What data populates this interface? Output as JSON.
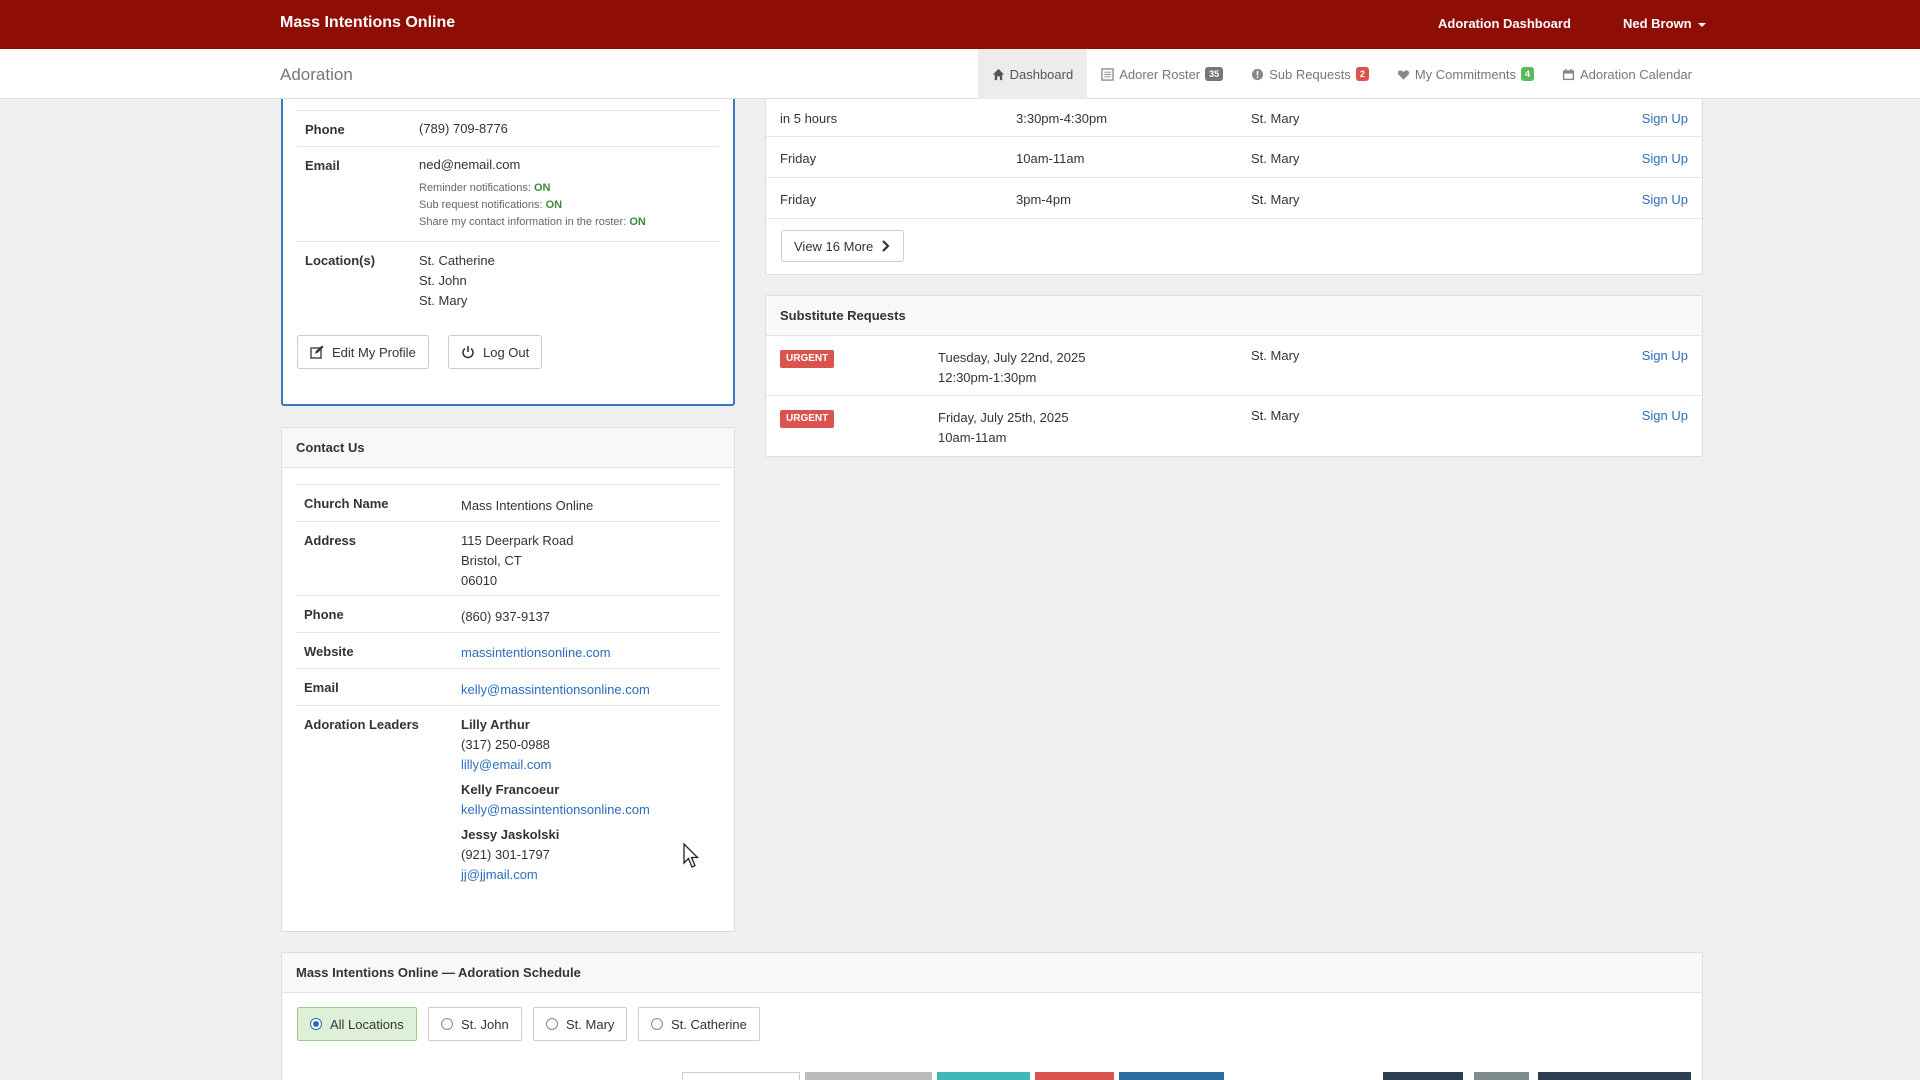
{
  "topbar": {
    "brand": "Mass Intentions Online",
    "dashboard_link": "Adoration Dashboard",
    "user_menu": "Ned Brown"
  },
  "subnav": {
    "title": "Adoration",
    "tabs": [
      {
        "label": "Dashboard",
        "icon": "home-icon",
        "badge": ""
      },
      {
        "label": "Adorer Roster",
        "icon": "list-icon",
        "badge": "35"
      },
      {
        "label": "Sub Requests",
        "icon": "info-icon",
        "badge": "2"
      },
      {
        "label": "My Commitments",
        "icon": "heart-icon",
        "badge": "4"
      },
      {
        "label": "Adoration Calendar",
        "icon": "calendar-icon",
        "badge": ""
      }
    ]
  },
  "profile": {
    "phone_label": "Phone",
    "phone": "(789) 709-8776",
    "email_label": "Email",
    "email": "ned@nemail.com",
    "reminder_label": "Reminder notifications:",
    "reminder_value": "ON",
    "subreq_label": "Sub request notifications:",
    "subreq_value": "ON",
    "share_label": "Share my contact information in the roster:",
    "share_value": "ON",
    "locations_label": "Location(s)",
    "locations": [
      "St. Catherine",
      "St. John",
      "St. Mary"
    ],
    "edit_button": "Edit My Profile",
    "logout_button": "Log Out"
  },
  "contact": {
    "heading": "Contact Us",
    "church_label": "Church Name",
    "church": "Mass Intentions Online",
    "address_label": "Address",
    "address": [
      "115 Deerpark Road",
      "Bristol, CT",
      "06010"
    ],
    "phone_label": "Phone",
    "phone": "(860) 937-9137",
    "website_label": "Website",
    "website": "massintentionsonline.com",
    "email_label": "Email",
    "email": "kelly@massintentionsonline.com",
    "leaders_label": "Adoration Leaders",
    "leaders": [
      {
        "name": "Lilly Arthur",
        "phone": "(317) 250-0988",
        "email": "lilly@email.com"
      },
      {
        "name": "Kelly Francoeur",
        "phone": "",
        "email": "kelly@massintentionsonline.com"
      },
      {
        "name": "Jessy Jaskolski",
        "phone": "(921) 301-1797",
        "email": "jj@jjmail.com"
      }
    ]
  },
  "open_hours": {
    "rows": [
      {
        "when": "in 5 hours",
        "time": "3:30pm-4:30pm",
        "location": "St. Mary",
        "action": "Sign Up"
      },
      {
        "when": "Friday",
        "time": "10am-11am",
        "location": "St. Mary",
        "action": "Sign Up"
      },
      {
        "when": "Friday",
        "time": "3pm-4pm",
        "location": "St. Mary",
        "action": "Sign Up"
      }
    ],
    "view_more": "View 16 More"
  },
  "sub_requests": {
    "heading": "Substitute Requests",
    "rows": [
      {
        "badge": "URGENT",
        "date": "Tuesday, July 22nd, 2025",
        "time": "12:30pm-1:30pm",
        "location": "St. Mary",
        "action": "Sign Up"
      },
      {
        "badge": "URGENT",
        "date": "Friday, July 25th, 2025",
        "time": "10am-11am",
        "location": "St. Mary",
        "action": "Sign Up"
      }
    ]
  },
  "schedule": {
    "heading": "Mass Intentions Online — Adoration Schedule",
    "filters": [
      "All Locations",
      "St. John",
      "St. Mary",
      "St. Catherine"
    ],
    "selected": "All Locations"
  },
  "colors": {
    "brand": "#8e0e05",
    "link": "#2a6ebb",
    "urgent": "#d9534f",
    "on": "#3c8a3c"
  }
}
